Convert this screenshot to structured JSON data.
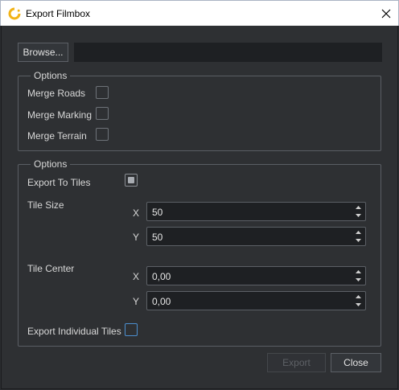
{
  "window": {
    "title": "Export Filmbox",
    "icon": "filmbox-logo-icon",
    "close_icon": "close-icon"
  },
  "browse": {
    "label": "Browse...",
    "path_value": ""
  },
  "merge_group": {
    "title": "Options",
    "merge_roads": {
      "label": "Merge Roads",
      "checked": false
    },
    "merge_marking": {
      "label": "Merge Marking",
      "checked": false
    },
    "merge_terrain": {
      "label": "Merge Terrain",
      "checked": false
    }
  },
  "tiles_group": {
    "title": "Options",
    "export_to_tiles": {
      "label": "Export To Tiles",
      "checked": true
    },
    "tile_size": {
      "label": "Tile Size",
      "x_label": "X",
      "x_value": "50",
      "y_label": "Y",
      "y_value": "50"
    },
    "tile_center": {
      "label": "Tile Center",
      "x_label": "X",
      "x_value": "0,00",
      "y_label": "Y",
      "y_value": "0,00"
    },
    "export_individual": {
      "label": "Export Individual Tiles",
      "checked": false
    }
  },
  "footer": {
    "export_label": "Export",
    "export_enabled": false,
    "close_label": "Close"
  },
  "colors": {
    "background": "#2e3033",
    "field": "#1e2023",
    "border": "#5a5e64",
    "accent_focus": "#4c8fd0",
    "logo": "#f2b316"
  }
}
